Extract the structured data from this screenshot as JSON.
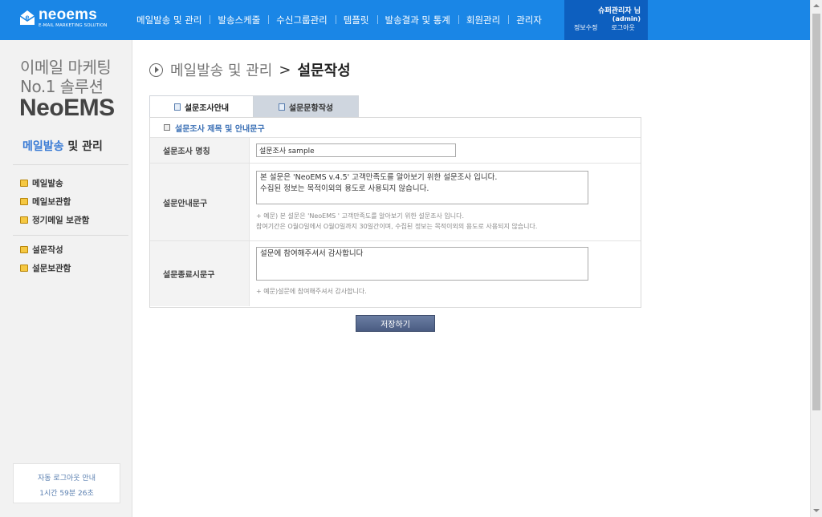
{
  "brand": {
    "name": "neoems",
    "tagline": "E-MAIL MARKETING SOLUTION",
    "accent": "#1a86e6"
  },
  "nav": [
    "메일발송 및 관리",
    "발송스케줄",
    "수신그룹관리",
    "템플릿",
    "발송결과 및 통계",
    "회원관리",
    "관리자"
  ],
  "user": {
    "name": "슈퍼관리자 님",
    "id": "(admin)",
    "edit_label": "정보수정",
    "logout_label": "로그아웃"
  },
  "sidebar": {
    "promo_line1": "이메일 마케팅",
    "promo_line2": "No.1 솔루션",
    "promo_brand": "NeoEMS",
    "section_hl": "메일발송",
    "section_rest": " 및 관리",
    "menu_group1": [
      "메일발송",
      "메일보관함",
      "정기메일 보관함"
    ],
    "menu_group2": [
      "설문작성",
      "설문보관함"
    ],
    "autologout_title": "자동 로그아웃 안내",
    "autologout_time": "1시간 59분 26초"
  },
  "breadcrumb": {
    "parent": "메일발송 및 관리",
    "sep": ">",
    "current": "설문작성"
  },
  "tabs": [
    "설문조사안내",
    "설문문항작성"
  ],
  "form": {
    "heading": "설문조사 제목 및 안내문구",
    "title_label": "설문조사 명칭",
    "title_value": "설문조사 sample",
    "guide_label": "설문안내문구",
    "guide_line1": "본 설문은 'NeoEMS v.4.5' 고객만족도를 알아보기 위한 설문조사 입니다.",
    "guide_line2": "수집된 정보는 목적이외의 용도로 사용되지 않습니다.",
    "guide_hint1": "+ 예문) 본 설문은 'NeoEMS ' 고객만족도를 알아보기 위한 설문조사 입니다.",
    "guide_hint2": "참여기간은 O월O일에서 O월O일까지 30일간이며, 수집된 정보는 목적이외의 용도로 사용되지 않습니다.",
    "end_label": "설문종료시문구",
    "end_value": "설문에 참여해주셔서 감사합니다",
    "end_hint": "+ 예문)설문에 참여해주셔서 감사합니다."
  },
  "save_label": "저장하기"
}
